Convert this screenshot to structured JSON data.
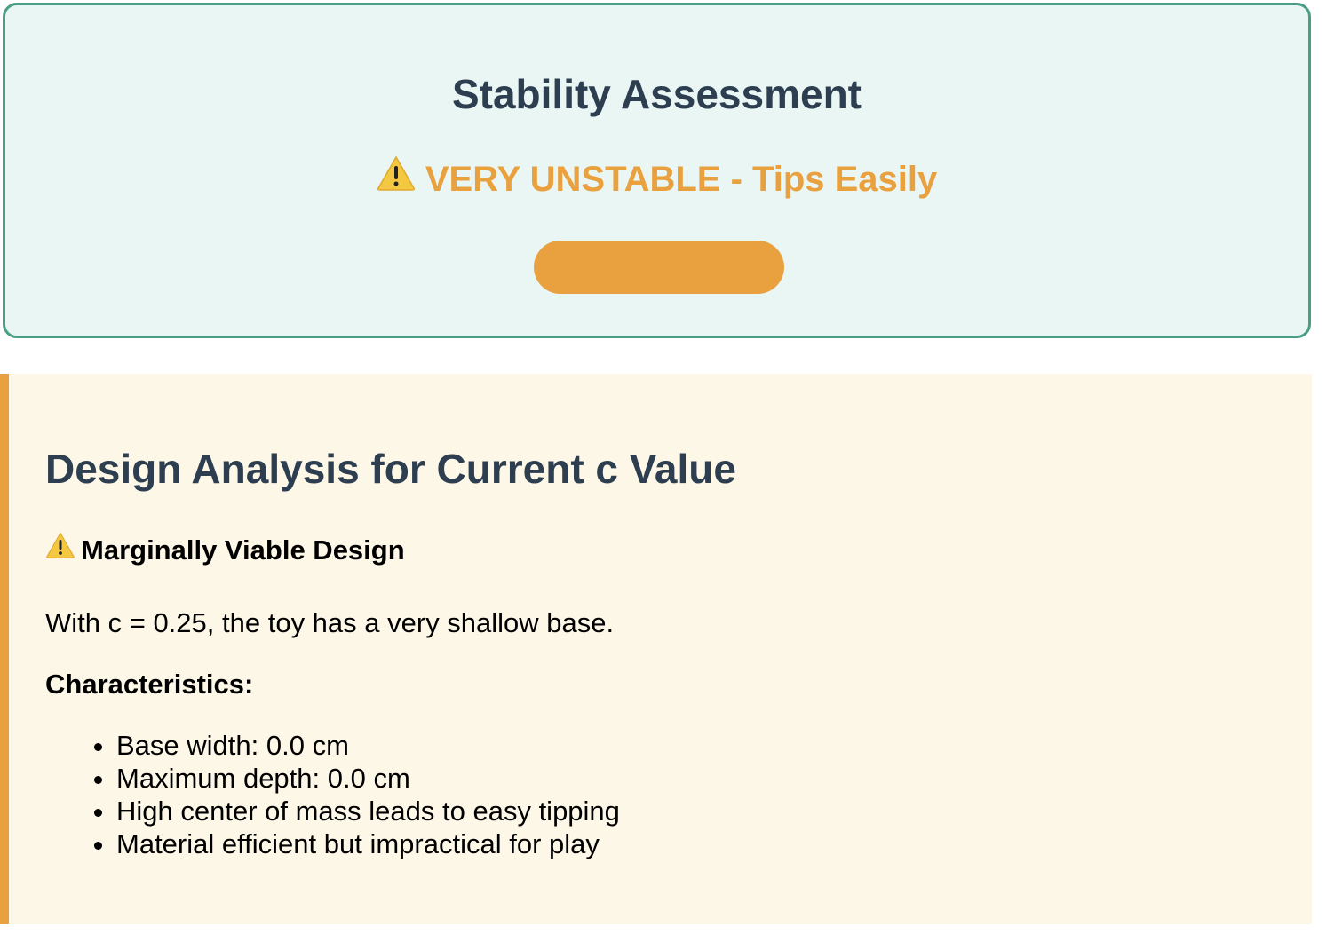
{
  "stability": {
    "title": "Stability Assessment",
    "status_icon": "warning-icon",
    "status_text": "VERY UNSTABLE - Tips Easily",
    "status_color": "#e8a13e",
    "card_border_color": "#4a9e86",
    "card_background": "#eaf6f3"
  },
  "analysis": {
    "title": "Design Analysis for Current c Value",
    "viability_icon": "warning-icon",
    "viability_text": "Marginally Viable Design",
    "summary": "With c = 0.25, the toy has a very shallow base.",
    "characteristics_label": "Characteristics:",
    "characteristics": [
      "Base width: 0.0 cm",
      "Maximum depth: 0.0 cm",
      "High center of mass leads to easy tipping",
      "Material efficient but impractical for play"
    ],
    "accent_color": "#e8a13e",
    "background": "#fdf7e7"
  }
}
